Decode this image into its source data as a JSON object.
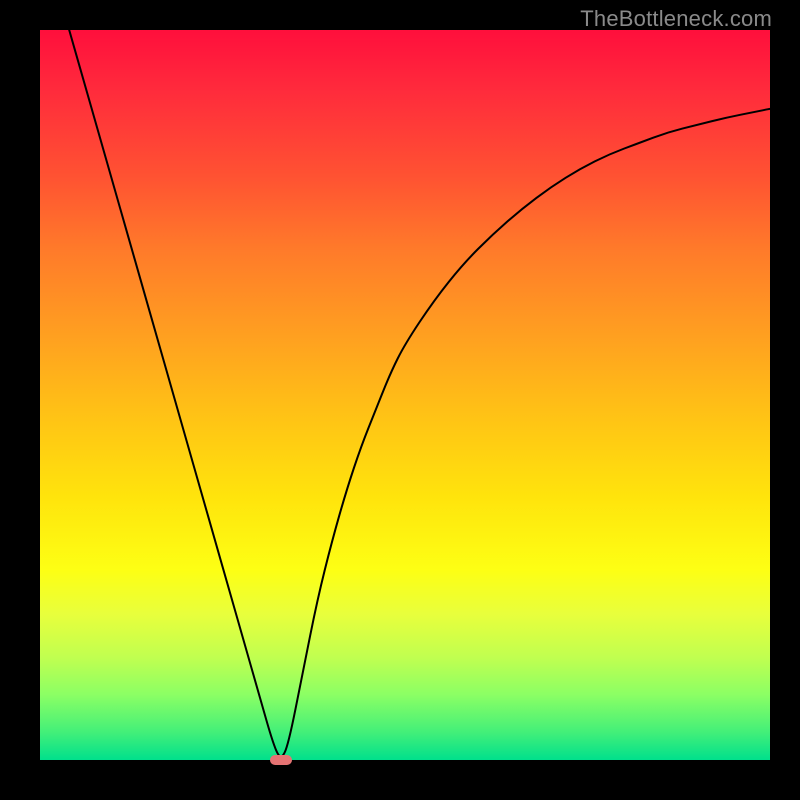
{
  "watermark": "TheBottleneck.com",
  "chart_data": {
    "type": "line",
    "title": "",
    "xlabel": "",
    "ylabel": "",
    "xlim": [
      0,
      100
    ],
    "ylim": [
      0,
      100
    ],
    "grid": false,
    "legend": false,
    "series": [
      {
        "name": "bottleneck-curve",
        "x": [
          4,
          6,
          8,
          10,
          12,
          14,
          16,
          18,
          20,
          22,
          24,
          26,
          28,
          30,
          32,
          33,
          34,
          36,
          38,
          40,
          42,
          44,
          46,
          48,
          50,
          54,
          58,
          62,
          66,
          70,
          74,
          78,
          82,
          86,
          90,
          94,
          98,
          100
        ],
        "y": [
          100,
          93,
          86,
          79,
          72,
          65,
          58,
          51,
          44,
          37,
          30,
          23,
          16,
          9,
          2,
          0,
          2,
          12,
          22,
          30,
          37,
          43,
          48,
          53,
          57,
          63,
          68,
          72,
          75.5,
          78.5,
          81,
          83,
          84.5,
          86,
          87,
          88,
          88.8,
          89.2
        ]
      }
    ],
    "marker": {
      "x": 33,
      "y": 0,
      "color": "#e57373"
    },
    "gradient_colors": [
      "#ff0f3c",
      "#ff7a2a",
      "#ffe40c",
      "#8cff64",
      "#00e08c"
    ]
  }
}
